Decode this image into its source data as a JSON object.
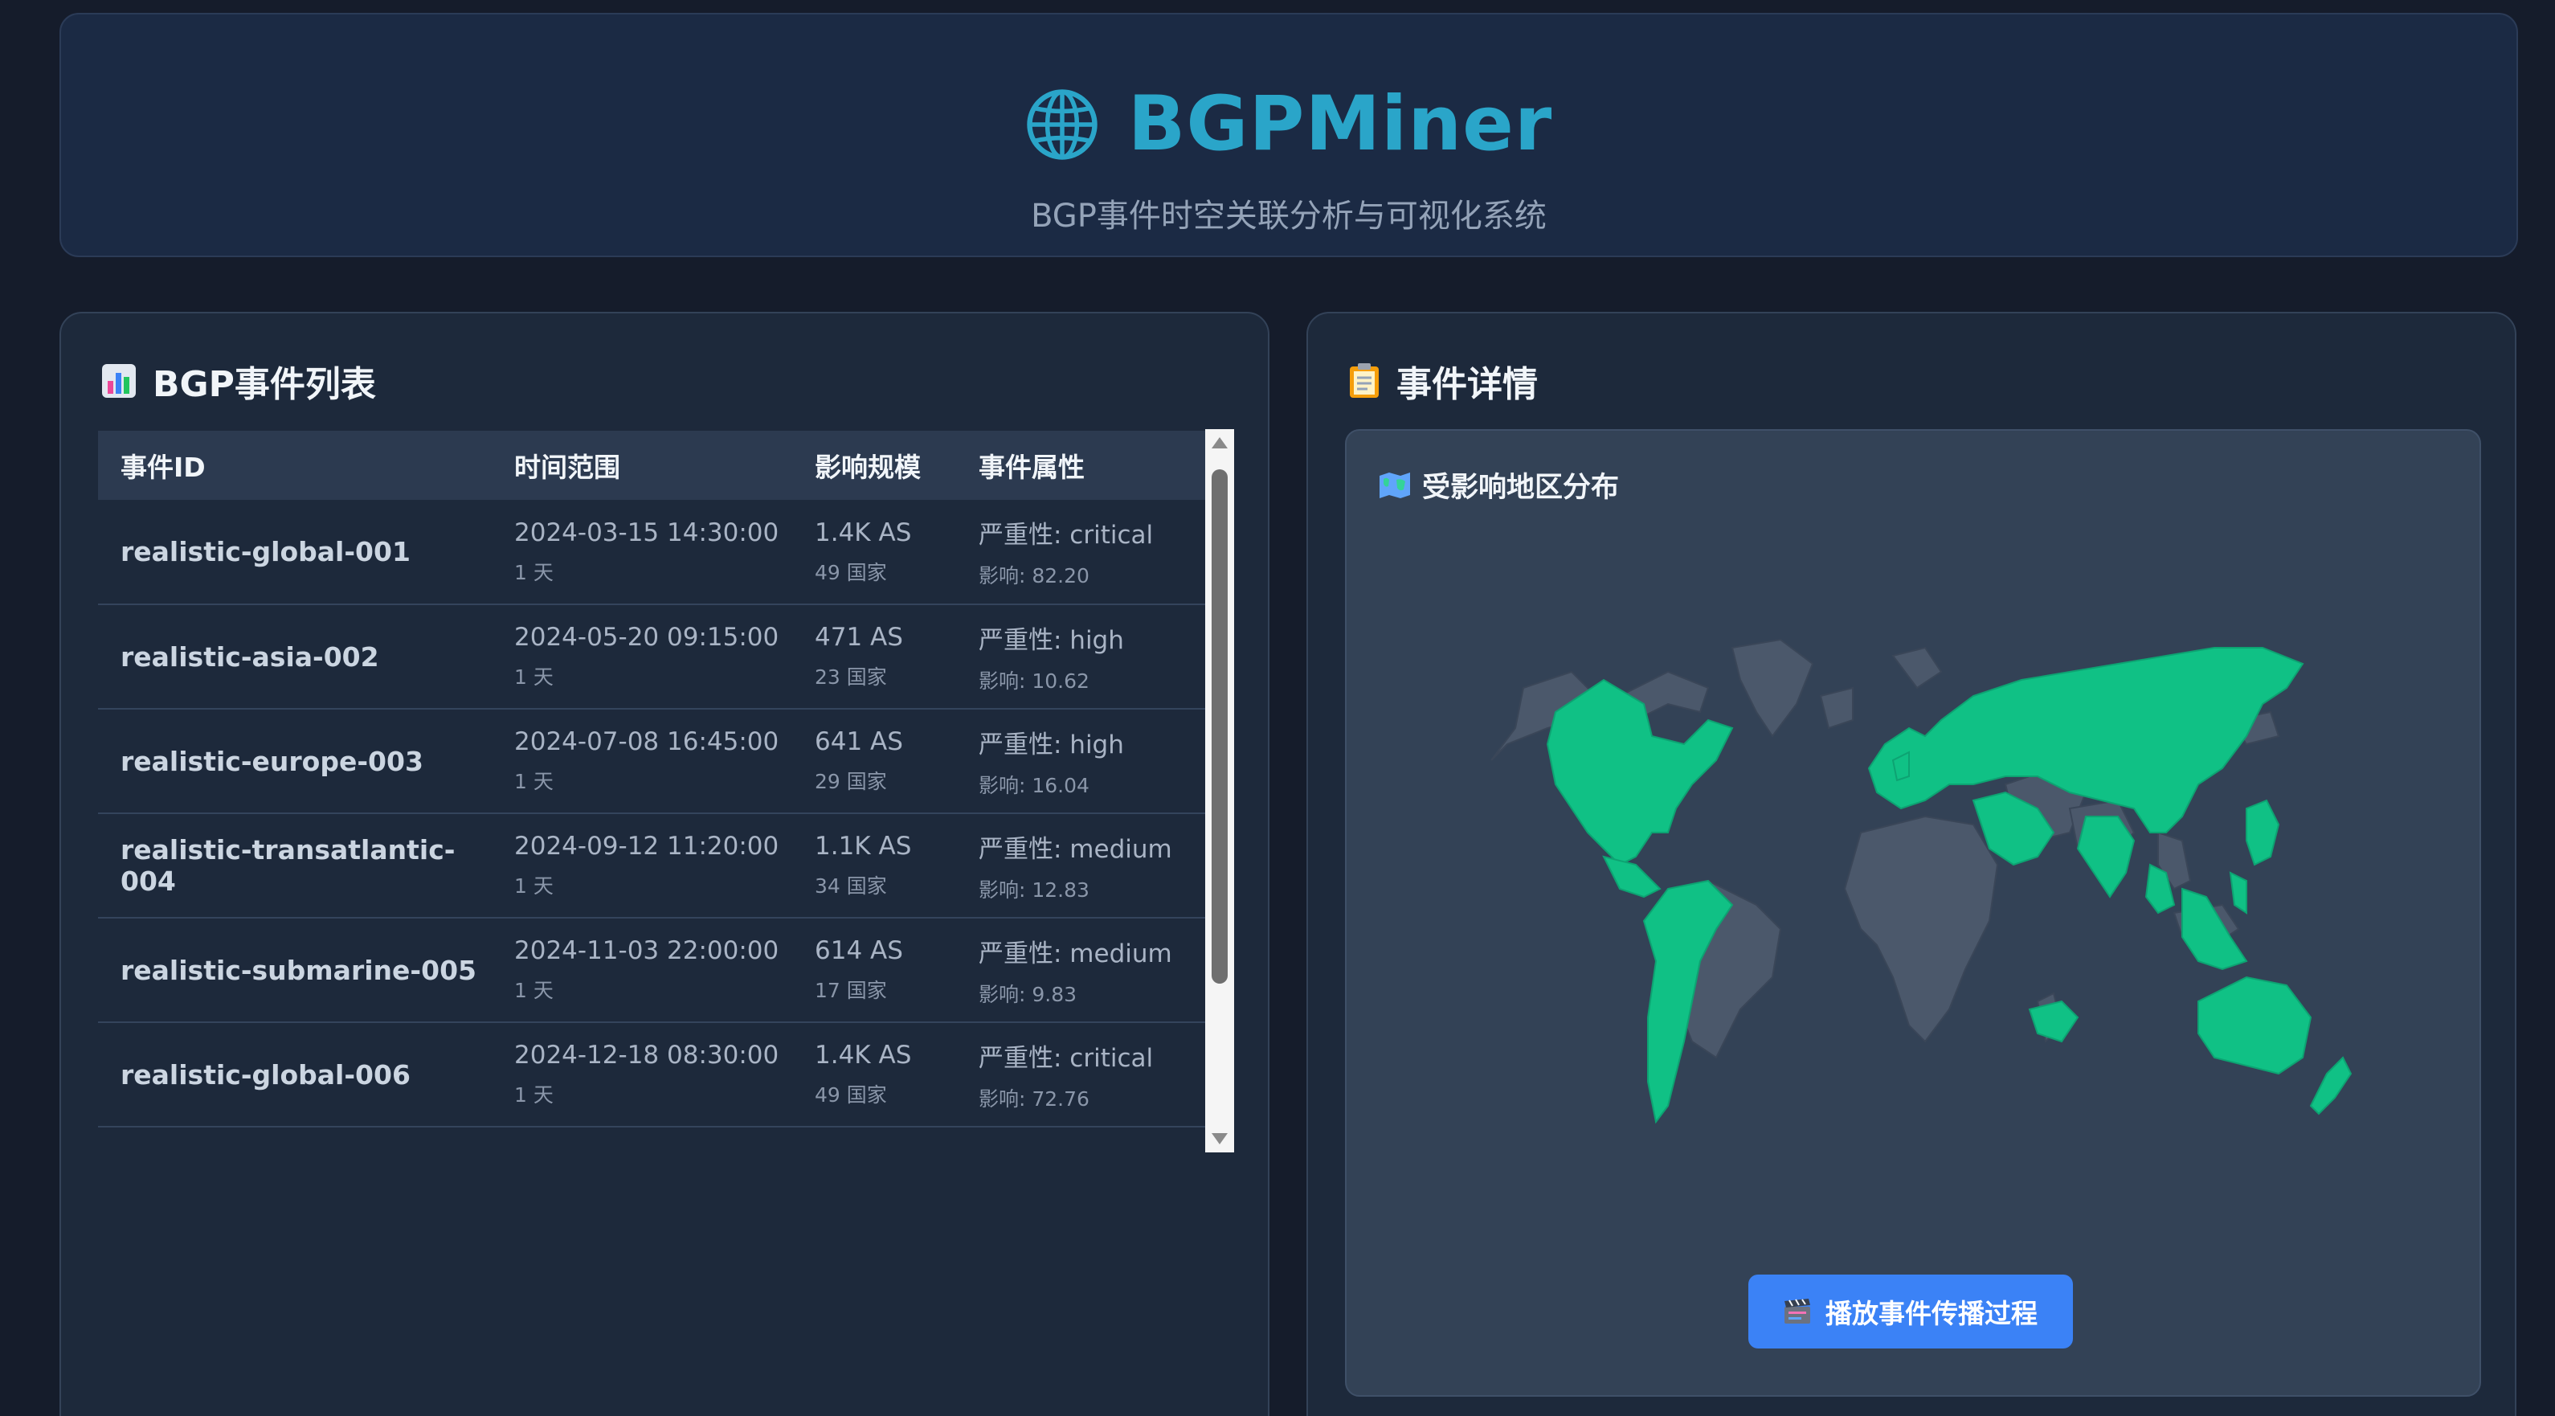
{
  "colors": {
    "brand": "#2aa5c9",
    "background": "#151c2b",
    "panel": "#1d293b",
    "affected_region": "#10c185",
    "unaffected_region": "#4b586b",
    "button": "#3b82f6"
  },
  "header": {
    "icon": "globe-icon",
    "title": "BGPMiner",
    "subtitle": "BGP事件时空关联分析与可视化系统"
  },
  "event_list": {
    "icon": "bar-chart-icon",
    "title": "BGP事件列表",
    "columns": [
      "事件ID",
      "时间范围",
      "影响规模",
      "事件属性"
    ],
    "rows": [
      {
        "id": "realistic-global-001",
        "time": "2024-03-15 14:30:00",
        "duration": "1 天",
        "as": "1.4K AS",
        "countries": "49 国家",
        "severity": "严重性: critical",
        "impact": "影响: 82.20"
      },
      {
        "id": "realistic-asia-002",
        "time": "2024-05-20 09:15:00",
        "duration": "1 天",
        "as": "471 AS",
        "countries": "23 国家",
        "severity": "严重性: high",
        "impact": "影响: 10.62"
      },
      {
        "id": "realistic-europe-003",
        "time": "2024-07-08 16:45:00",
        "duration": "1 天",
        "as": "641 AS",
        "countries": "29 国家",
        "severity": "严重性: high",
        "impact": "影响: 16.04"
      },
      {
        "id": "realistic-transatlantic-004",
        "time": "2024-09-12 11:20:00",
        "duration": "1 天",
        "as": "1.1K AS",
        "countries": "34 国家",
        "severity": "严重性: medium",
        "impact": "影响: 12.83"
      },
      {
        "id": "realistic-submarine-005",
        "time": "2024-11-03 22:00:00",
        "duration": "1 天",
        "as": "614 AS",
        "countries": "17 国家",
        "severity": "严重性: medium",
        "impact": "影响: 9.83"
      },
      {
        "id": "realistic-global-006",
        "time": "2024-12-18 08:30:00",
        "duration": "1 天",
        "as": "1.4K AS",
        "countries": "49 国家",
        "severity": "严重性: critical",
        "impact": "影响: 72.76"
      }
    ]
  },
  "event_detail": {
    "icon": "clipboard-icon",
    "title": "事件详情",
    "map_icon": "world-map-icon",
    "map_title": "受影响地区分布",
    "play_icon": "clapperboard-icon",
    "play_button": "播放事件传播过程"
  }
}
